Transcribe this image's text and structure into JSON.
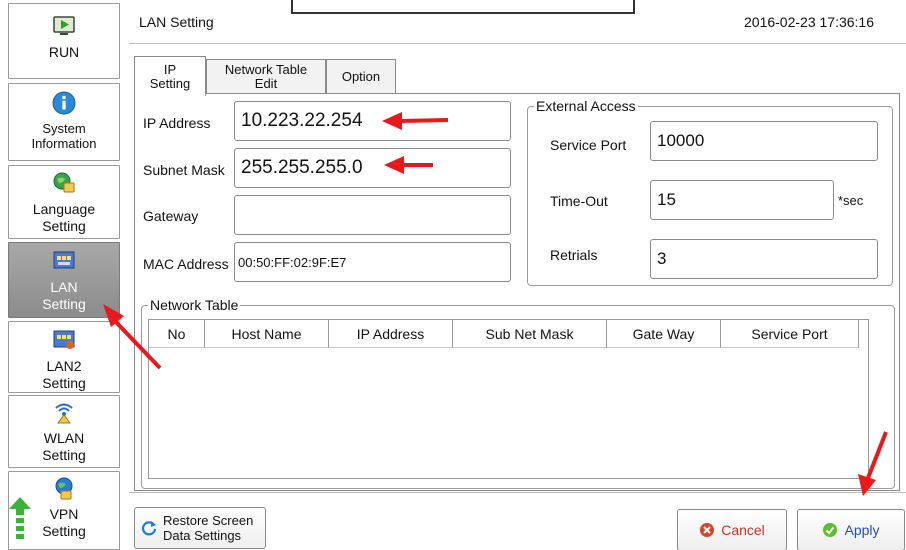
{
  "sidebar": {
    "items": [
      {
        "label": "RUN",
        "icon": "play-screen-icon"
      },
      {
        "label": "System\nInformation",
        "icon": "info-icon"
      },
      {
        "label": "Language\nSetting",
        "icon": "language-icon"
      },
      {
        "label": "LAN\nSetting",
        "icon": "lan-icon"
      },
      {
        "label": "LAN2\nSetting",
        "icon": "lan2-icon"
      },
      {
        "label": "WLAN\nSetting",
        "icon": "wlan-icon"
      },
      {
        "label": "VPN\nSetting",
        "icon": "vpn-icon"
      }
    ],
    "active_index": 3
  },
  "header": {
    "title": "LAN Setting",
    "datetime": "2016-02-23 17:36:16"
  },
  "tabs": [
    {
      "label": "IP\nSetting"
    },
    {
      "label": "Network Table\nEdit"
    },
    {
      "label": "Option"
    }
  ],
  "ip_setting": {
    "ip_address": {
      "label": "IP Address",
      "value": "10.223.22.254"
    },
    "subnet_mask": {
      "label": "Subnet Mask",
      "value": "255.255.255.0"
    },
    "gateway": {
      "label": "Gateway",
      "value": ""
    },
    "mac_address": {
      "label": "MAC Address",
      "value": "00:50:FF:02:9F:E7"
    }
  },
  "external_access": {
    "legend": "External Access",
    "service_port": {
      "label": "Service Port",
      "value": "10000"
    },
    "time_out": {
      "label": "Time-Out",
      "value": "15",
      "unit": "*sec"
    },
    "retrials": {
      "label": "Retrials",
      "value": "3"
    }
  },
  "network_table": {
    "legend": "Network Table",
    "columns": [
      "No",
      "Host Name",
      "IP Address",
      "Sub Net Mask",
      "Gate Way",
      "Service Port"
    ],
    "rows": []
  },
  "footer": {
    "restore_label": "Restore Screen\nData Settings",
    "cancel_label": "Cancel",
    "apply_label": "Apply"
  },
  "colors": {
    "annotation_arrow": "#e8181c",
    "active_sidebar": "#9a9a9a",
    "cancel_icon": "#d9432a",
    "apply_icon": "#5cbf2a"
  }
}
